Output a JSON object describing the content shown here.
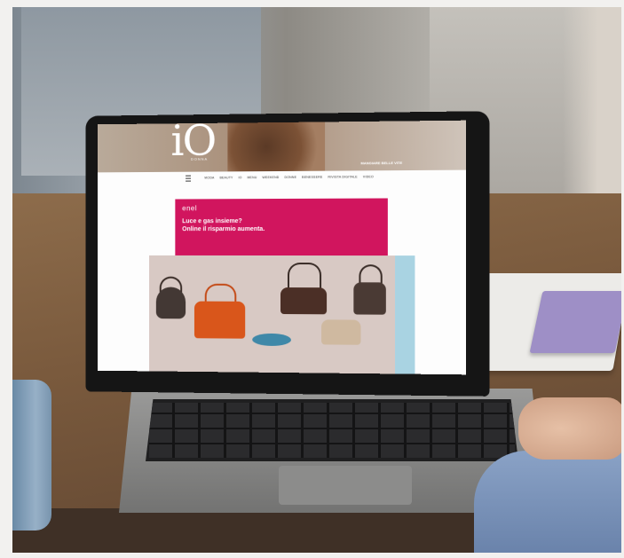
{
  "website": {
    "logo": "iO",
    "logo_subtitle": "DONNA",
    "header_tagline": "MANGIARE BELLE VITE",
    "nav_items": [
      "MODA",
      "BEAUTY",
      "IO",
      "MENU",
      "WEEKEND",
      "DONNE",
      "BENESSERE",
      "RIVISTA DIGITALE",
      "VIDEO"
    ],
    "ad": {
      "brand": "enel",
      "line1": "Luce e gas insieme?",
      "line2": "Online il risparmio aumenta."
    }
  },
  "colors": {
    "ad_background": "#d1155e",
    "bag_orange": "#d9561b",
    "panel_accent": "#a9d3e2"
  }
}
